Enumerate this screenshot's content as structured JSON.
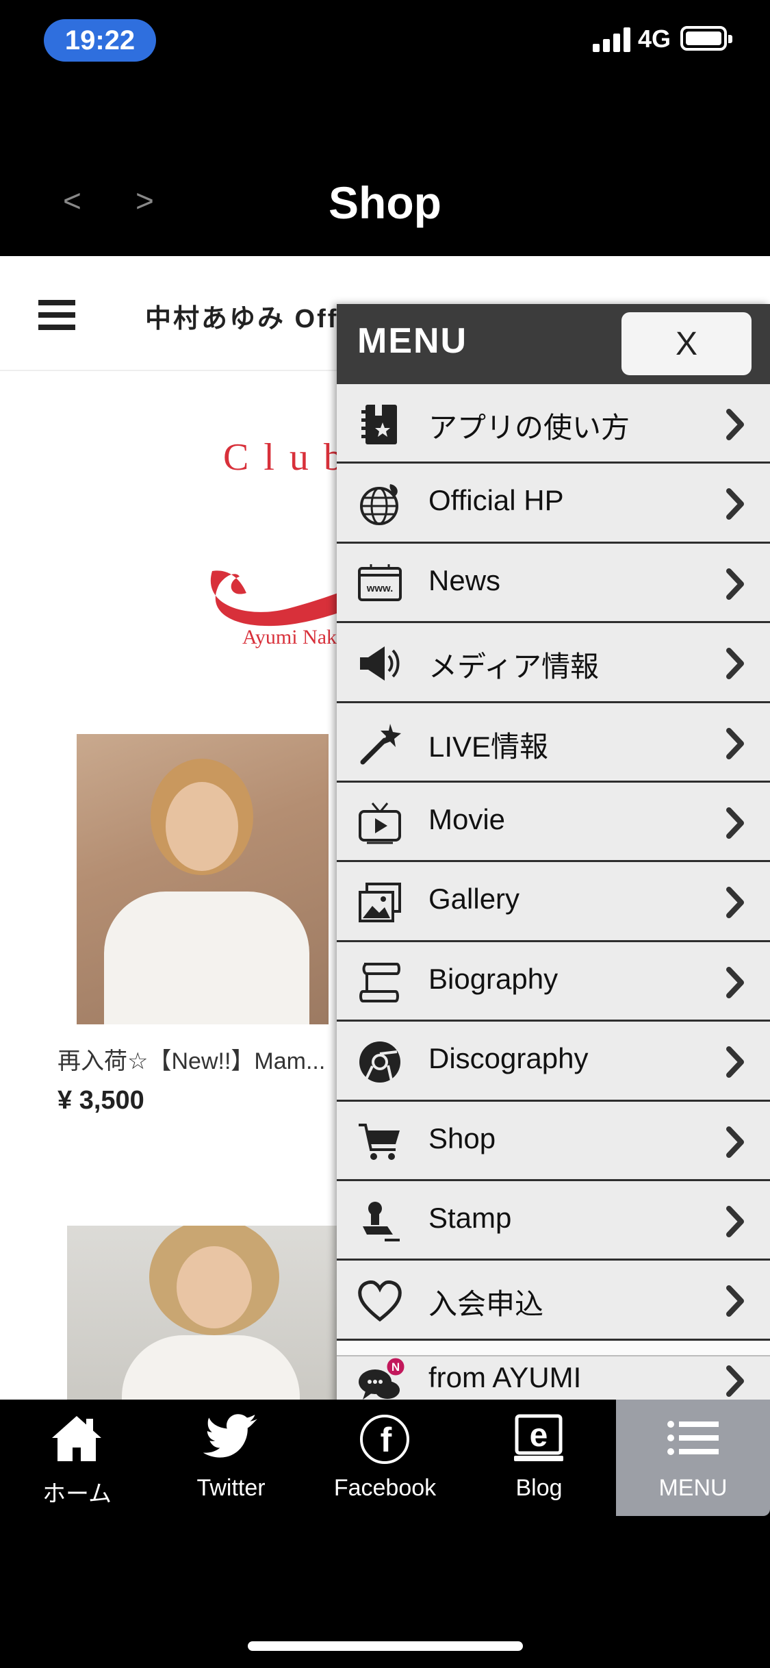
{
  "status_bar": {
    "time": "19:22",
    "network": "4G"
  },
  "title_bar": {
    "back_label": "<",
    "forward_label": ">",
    "title": "Shop"
  },
  "site": {
    "title": "中村あゆみ Official Shop Club Ayumi",
    "logo_text": "Club",
    "logo_sub": "Ayumi Nakamura"
  },
  "products": [
    {
      "name": "再入荷☆【New!!】Mam...",
      "price": "¥ 3,500"
    }
  ],
  "menu": {
    "heading": "MENU",
    "close_label": "X",
    "items": [
      {
        "label": "アプリの使い方",
        "icon": "book-star-icon"
      },
      {
        "label": "Official HP",
        "icon": "globe-icon"
      },
      {
        "label": "News",
        "icon": "www-browser-icon"
      },
      {
        "label": "メディア情報",
        "icon": "megaphone-icon"
      },
      {
        "label": "LIVE情報",
        "icon": "magic-wand-icon"
      },
      {
        "label": "Movie",
        "icon": "tv-play-icon"
      },
      {
        "label": "Gallery",
        "icon": "gallery-images-icon"
      },
      {
        "label": "Biography",
        "icon": "scroll-icon"
      },
      {
        "label": "Discography",
        "icon": "disc-icon"
      },
      {
        "label": "Shop",
        "icon": "cart-icon"
      },
      {
        "label": "Stamp",
        "icon": "stamp-icon"
      },
      {
        "label": "入会申込",
        "icon": "heart-icon"
      },
      {
        "label": "from AYUMI",
        "icon": "chat-bubbles-icon",
        "badge": "N"
      }
    ]
  },
  "tab_bar": {
    "tabs": [
      {
        "label": "ホーム",
        "icon": "home-icon"
      },
      {
        "label": "Twitter",
        "icon": "twitter-icon"
      },
      {
        "label": "Facebook",
        "icon": "facebook-icon"
      },
      {
        "label": "Blog",
        "icon": "blog-icon"
      },
      {
        "label": "MENU",
        "icon": "menu-list-icon",
        "active": true
      }
    ]
  },
  "colors": {
    "accent_blue": "#2f6fde",
    "logo_red": "#d8303a",
    "menu_header": "#3c3c3c",
    "badge_pink": "#c2185b",
    "active_tab": "#9c9fa6"
  }
}
